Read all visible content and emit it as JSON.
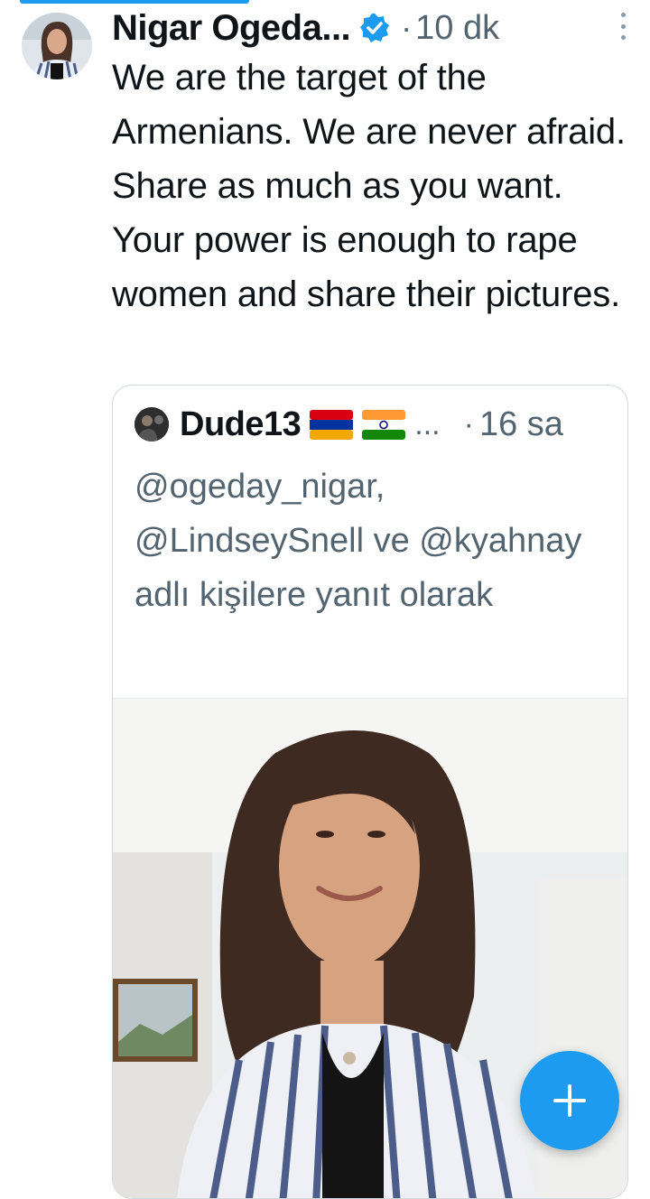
{
  "tweet": {
    "author_name": "Nigar Ogeda...",
    "separator": "·",
    "time": "10 dk",
    "text": "We are the target of the Armenians. We are never afraid. Share as much as you want. Your power is enough to rape women and share their pictures."
  },
  "quoted_tweet": {
    "author_name": "Dude13",
    "flags": [
      "armenia-flag",
      "india-flag"
    ],
    "ellipsis": "...",
    "separator": "·",
    "time": "16 sa",
    "reply_context": "@ogeday_nigar, @LindseySnell ve @kyahnay adlı kişilere yanıt olarak"
  },
  "icons": {
    "verified": "verified-badge-icon",
    "more": "more-vertical-icon",
    "compose": "plus-icon"
  },
  "colors": {
    "accent": "#1d9bf0",
    "secondary_text": "#536471",
    "primary_text": "#0f1419"
  }
}
